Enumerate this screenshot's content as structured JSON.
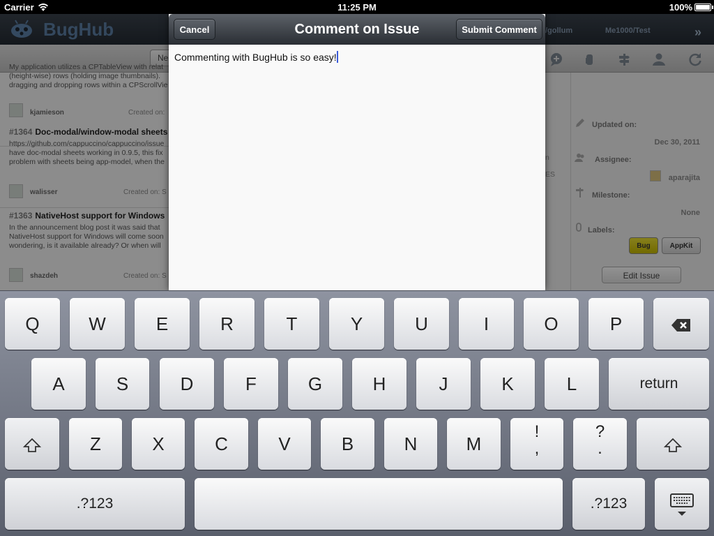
{
  "status_bar": {
    "carrier": "Carrier",
    "time": "11:25 PM",
    "battery": "100%"
  },
  "app": {
    "title": "BugHub",
    "header_repos": [
      "/gollum",
      "Me1000/Test"
    ],
    "new_button": "Ne",
    "issues": [
      {
        "number": "",
        "title": "",
        "body": [
          "My application utilizes a CPTableView with relat",
          "(height-wise) rows (holding image thumbnails).",
          "dragging and dropping rows within a CPScrollVie"
        ],
        "user": "kjamieson",
        "created": "Created on:"
      },
      {
        "number": "#1364",
        "title": "Doc-modal/window-modal sheets",
        "body": [
          "https://github.com/cappuccino/cappuccino/issue",
          "have doc-modal sheets working in 0.9.5, this fix",
          "problem with sheets being app-model, when the"
        ],
        "user": "walisser",
        "created": "Created on:  S"
      },
      {
        "number": "#1363",
        "title": "NativeHost support for Windows",
        "body": [
          "In the announcement blog post it was said that",
          "NativeHost support for Windows will come soon",
          "wondering, is it available already? Or when will"
        ],
        "user": "shazdeh",
        "created": "Created on:  S"
      }
    ],
    "detail": {
      "updated_label": "Updated on:",
      "updated_value": "Dec 30, 2011",
      "assignee_label": "Assignee:",
      "assignee_value": "aparajita",
      "milestone_label": "Milestone:",
      "milestone_value": "None",
      "labels_label": "Labels:",
      "labels": [
        "Bug",
        "AppKit"
      ],
      "edit_button": "Edit Issue",
      "fragments": [
        "n",
        "ES"
      ]
    }
  },
  "modal": {
    "title": "Comment on Issue",
    "cancel": "Cancel",
    "submit": "Submit Comment",
    "comment_text": "Commenting with BugHub is so easy!"
  },
  "keyboard": {
    "row1": [
      "Q",
      "W",
      "E",
      "R",
      "T",
      "Y",
      "U",
      "I",
      "O",
      "P"
    ],
    "row2": [
      "A",
      "S",
      "D",
      "F",
      "G",
      "H",
      "J",
      "K",
      "L"
    ],
    "row3": [
      "Z",
      "X",
      "C",
      "V",
      "B",
      "N",
      "M"
    ],
    "return": "return",
    "numbers": ".?123",
    "punct1": [
      "!",
      ","
    ],
    "punct2": [
      "?",
      "."
    ]
  }
}
